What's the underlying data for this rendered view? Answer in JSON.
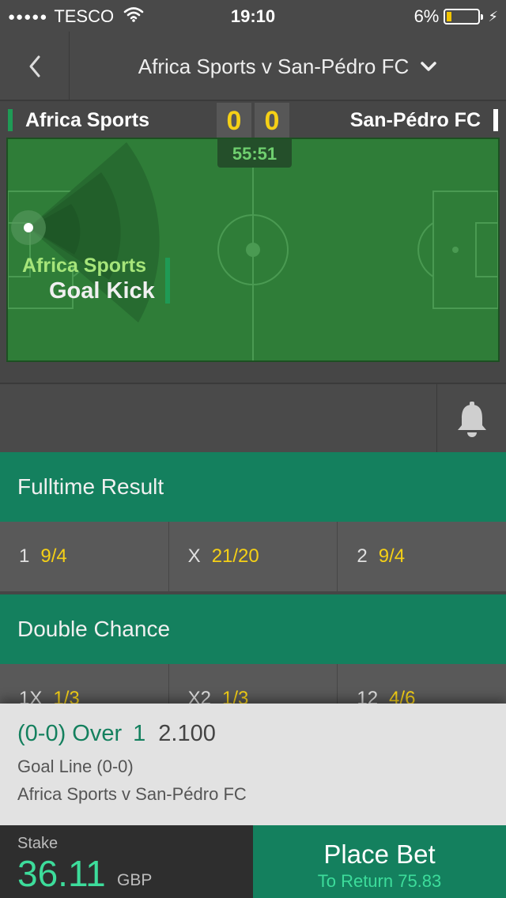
{
  "status_bar": {
    "signal": "●●●●●",
    "carrier": "TESCO",
    "time": "19:10",
    "battery": "6%"
  },
  "header": {
    "title": "Africa Sports v San-Pédro FC"
  },
  "scoreboard": {
    "home_team": "Africa Sports",
    "away_team": "San-Pédro FC",
    "home_score": "0",
    "away_score": "0",
    "clock": "55:51"
  },
  "pitch_event": {
    "team": "Africa Sports",
    "event": "Goal Kick"
  },
  "markets": [
    {
      "title": "Fulltime Result",
      "selections": [
        {
          "name": "1",
          "price": "9/4"
        },
        {
          "name": "X",
          "price": "21/20"
        },
        {
          "name": "2",
          "price": "9/4"
        }
      ]
    },
    {
      "title": "Double Chance",
      "selections": [
        {
          "name": "1X",
          "price": "1/3"
        },
        {
          "name": "X2",
          "price": "1/3"
        },
        {
          "name": "12",
          "price": "4/6"
        }
      ]
    }
  ],
  "betslip": {
    "selection": "(0-0) Over",
    "handicap": "1",
    "odds": "2.100",
    "market": "Goal Line (0-0)",
    "event": "Africa Sports v San-Pédro FC"
  },
  "stake": {
    "label": "Stake",
    "value": "36.11",
    "currency": "GBP"
  },
  "place_bet": {
    "label": "Place Bet",
    "return_text": "To Return 75.83"
  },
  "colors": {
    "brand_green": "#14805e",
    "odds_yellow": "#f5d016",
    "pitch_green": "#2f7d38",
    "stake_green": "#3ddc9b"
  }
}
